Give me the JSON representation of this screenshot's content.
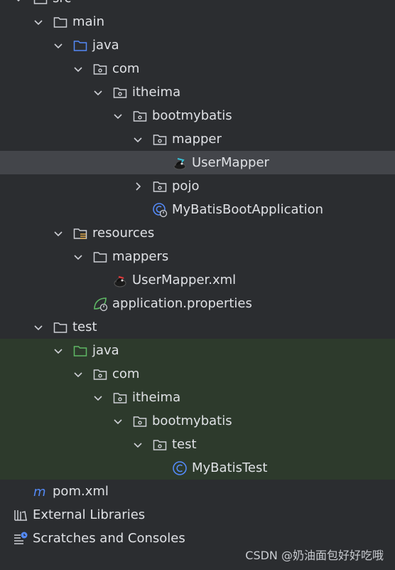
{
  "tree": {
    "items": [
      {
        "label": "src"
      },
      {
        "label": "main"
      },
      {
        "label": "java"
      },
      {
        "label": "com"
      },
      {
        "label": "itheima"
      },
      {
        "label": "bootmybatis"
      },
      {
        "label": "mapper"
      },
      {
        "label": "UserMapper"
      },
      {
        "label": "pojo"
      },
      {
        "label": "MyBatisBootApplication"
      },
      {
        "label": "resources"
      },
      {
        "label": "mappers"
      },
      {
        "label": "UserMapper.xml"
      },
      {
        "label": "application.properties"
      },
      {
        "label": "test"
      },
      {
        "label": "java"
      },
      {
        "label": "com"
      },
      {
        "label": "itheima"
      },
      {
        "label": "bootmybatis"
      },
      {
        "label": "test"
      },
      {
        "label": "MyBatisTest"
      },
      {
        "label": "pom.xml"
      },
      {
        "label": "External Libraries"
      },
      {
        "label": "Scratches and Consoles"
      }
    ]
  },
  "watermark": "CSDN @奶油面包好好吃哦",
  "colors": {
    "background": "#2b2d30",
    "selected_row": "#43454a",
    "test_sources_bg": "#2d3a2c",
    "java_source_folder": "#548af7",
    "test_source_folder": "#5fb865",
    "class_icon": "#548af7"
  }
}
